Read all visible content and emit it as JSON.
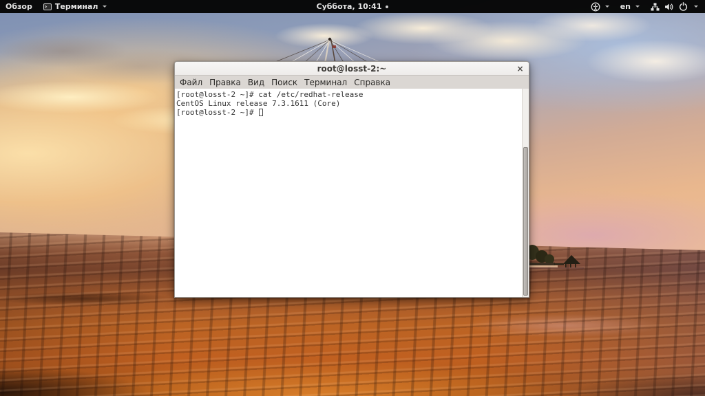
{
  "panel": {
    "activities_label": "Обзор",
    "app_menu_label": "Терминал",
    "clock": "Суббота, 10:41",
    "keyboard_layout": "en"
  },
  "terminal_window": {
    "title": "root@losst-2:~",
    "close_label": "×",
    "menu": [
      "Файл",
      "Правка",
      "Вид",
      "Поиск",
      "Терминал",
      "Справка"
    ],
    "lines": [
      "[root@losst-2 ~]# cat /etc/redhat-release",
      "CentOS Linux release 7.3.1611 (Core)"
    ],
    "prompt": "[root@losst-2 ~]# "
  },
  "colors": {
    "panel_bg": "#050505",
    "titlebar_bg": "#f3f1ef",
    "menubar_bg": "#dbd7d3",
    "terminal_bg": "#ffffff",
    "terminal_fg": "#333333",
    "sea_accent": "#c06020",
    "sky_accent": "#7d8fb2"
  }
}
